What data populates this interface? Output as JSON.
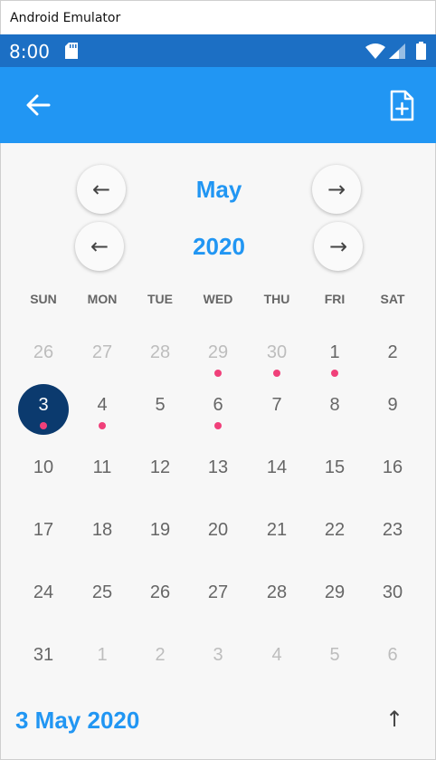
{
  "window": {
    "title": "Android Emulator"
  },
  "statusbar": {
    "time": "8:00"
  },
  "calendar": {
    "month_prev_arrow": "←",
    "month_next_arrow": "→",
    "year_prev_arrow": "←",
    "year_next_arrow": "→",
    "month": "May",
    "year": "2020",
    "weekdays": [
      "SUN",
      "MON",
      "TUE",
      "WED",
      "THU",
      "FRI",
      "SAT"
    ],
    "weeks": [
      [
        {
          "d": "26",
          "other": true
        },
        {
          "d": "27",
          "other": true
        },
        {
          "d": "28",
          "other": true
        },
        {
          "d": "29",
          "other": true,
          "dot": true
        },
        {
          "d": "30",
          "other": true,
          "dot": true
        },
        {
          "d": "1",
          "dot": true
        },
        {
          "d": "2"
        }
      ],
      [
        {
          "d": "3",
          "selected": true,
          "dot": true
        },
        {
          "d": "4",
          "dot": true
        },
        {
          "d": "5"
        },
        {
          "d": "6",
          "dot": true
        },
        {
          "d": "7"
        },
        {
          "d": "8"
        },
        {
          "d": "9"
        }
      ],
      [
        {
          "d": "10"
        },
        {
          "d": "11"
        },
        {
          "d": "12"
        },
        {
          "d": "13"
        },
        {
          "d": "14"
        },
        {
          "d": "15"
        },
        {
          "d": "16"
        }
      ],
      [
        {
          "d": "17"
        },
        {
          "d": "18"
        },
        {
          "d": "19"
        },
        {
          "d": "20"
        },
        {
          "d": "21"
        },
        {
          "d": "22"
        },
        {
          "d": "23"
        }
      ],
      [
        {
          "d": "24"
        },
        {
          "d": "25"
        },
        {
          "d": "26"
        },
        {
          "d": "27"
        },
        {
          "d": "28"
        },
        {
          "d": "29"
        },
        {
          "d": "30"
        }
      ],
      [
        {
          "d": "31"
        },
        {
          "d": "1",
          "other": true
        },
        {
          "d": "2",
          "other": true
        },
        {
          "d": "3",
          "other": true
        },
        {
          "d": "4",
          "other": true
        },
        {
          "d": "5",
          "other": true
        },
        {
          "d": "6",
          "other": true
        }
      ]
    ],
    "selected_date": "3 May 2020",
    "scroll_up_arrow": "↑"
  },
  "colors": {
    "statusbar": "#1c6fc4",
    "appbar": "#2196f3",
    "accent": "#2196f3",
    "selected_day": "#0b3a6e",
    "event_dot": "#f0407a"
  },
  "icons": {
    "back": "back-arrow-icon",
    "add_document": "add-document-icon",
    "sd_card": "sd-card-icon",
    "wifi": "wifi-icon",
    "signal": "signal-icon",
    "battery": "battery-icon"
  }
}
